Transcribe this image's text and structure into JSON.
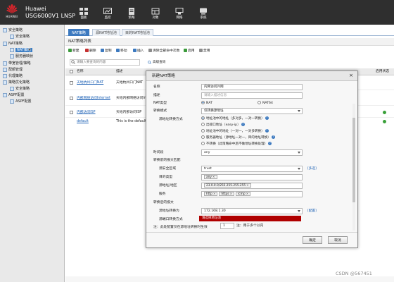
{
  "header": {
    "brand": "HUAWEI",
    "product": "Huawei",
    "model": "USG6000V1 LNSP",
    "nav": [
      {
        "label": "面板",
        "icon": "dashboard-icon"
      },
      {
        "label": "监控",
        "icon": "monitor-icon"
      },
      {
        "label": "策略",
        "icon": "policy-icon"
      },
      {
        "label": "对象",
        "icon": "object-icon"
      },
      {
        "label": "网络",
        "icon": "network-icon"
      },
      {
        "label": "系统",
        "icon": "system-icon"
      }
    ]
  },
  "sidebar": {
    "items": [
      {
        "label": "安全策略",
        "level": 0
      },
      {
        "label": "安全策略",
        "level": 1
      },
      {
        "label": "NAT策略",
        "level": 0
      },
      {
        "label": "NAT策略",
        "level": 1,
        "selected": true
      },
      {
        "label": "服务器映射",
        "level": 1
      },
      {
        "label": "带宽管理/策略",
        "level": 0
      },
      {
        "label": "配额管理",
        "level": 0
      },
      {
        "label": "代理策略",
        "level": 0
      },
      {
        "label": "策略优化策略",
        "level": 0
      },
      {
        "label": "安全策略",
        "level": 1
      },
      {
        "label": "ASPF配置",
        "level": 1
      },
      {
        "label": "ASPF配置",
        "level": 1
      }
    ]
  },
  "tabs": [
    "NAT策略",
    "源NAT地址池",
    "目的NAT地址池"
  ],
  "panel_title": "NAT策略列表",
  "toolbar": [
    {
      "label": "新建",
      "color": "#3a9a3a"
    },
    {
      "label": "删除",
      "color": "#c53030"
    },
    {
      "label": "复制",
      "color": "#3c79bf"
    },
    {
      "label": "移动",
      "color": "#3c79bf"
    },
    {
      "label": "插入",
      "color": "#3c79bf"
    },
    {
      "label": "清除全部命中次数",
      "color": "#8a8a8a"
    },
    {
      "label": "启用",
      "color": "#3a9a3a"
    },
    {
      "label": "禁用",
      "color": "#8a8a8a"
    }
  ],
  "search": {
    "placeholder": "请输入要查询的内容",
    "advanced": "高级查询"
  },
  "table": {
    "headers": [
      "名称",
      "描述",
      "启用状态"
    ],
    "rows": [
      {
        "name": "天地杭州口门NAT",
        "desc": "天地杭州口门NAT"
      },
      {
        "name": "内部网络访问Internet",
        "desc": "天地内部网络访问Internet"
      },
      {
        "name": "内部访问ISP",
        "desc": "天地内部访问ISP"
      },
      {
        "name": "default",
        "desc": "This is the default ru"
      }
    ]
  },
  "dialog": {
    "title": "新建NAT策略",
    "close": "×",
    "fields": {
      "name_label": "名称",
      "name_value": "内网访问外网",
      "desc_label": "描述",
      "desc_placeholder": "请输入描述信息",
      "nat_type_label": "NAT类型",
      "nat_type_options": [
        "NAT",
        "NAT64"
      ],
      "convert_label": "转换模式",
      "convert_value": "仅转换源地址",
      "time_label": "时间段",
      "time_value": "any",
      "source_mode_label": "源地址转换方式",
      "source_modes": [
        "地址池中的地址（多对多，一对一转换）",
        "出接口地址（easy-ip）",
        "地址池中的地址（一对一，一对多转换）",
        "服务器地址（源地址一对一，目的地址转换）",
        "不转换（此策略命中后不做地址转换处理）"
      ]
    },
    "match_section": "转换前的报文匹配",
    "match": {
      "src_zone_label": "源安全区域",
      "src_zone_value": "trust",
      "multi_link": "[多选]",
      "dst_type_label": "目的类型",
      "dst_zone": "any",
      "src_addr_label": "源地址/地区",
      "src_addr_value": "23.0.0.0/255.255.255.255",
      "service_label": "服务",
      "services": [
        "http",
        "https",
        "icmp"
      ]
    },
    "after_section": "转换后的报文",
    "after": {
      "pool_label": "源地址转换为",
      "pool_value": "172.168.1.30",
      "pool_link": "[配置]",
      "error_text": "请选择地址池",
      "port_label": "源端口转换方式",
      "port_value": "1",
      "port_suffix": "注：用于多个以内",
      "note": "注：此处配置仅在源地址转换时生效"
    },
    "ok": "确定",
    "cancel": "取消"
  },
  "watermark": "CSDN @567451"
}
